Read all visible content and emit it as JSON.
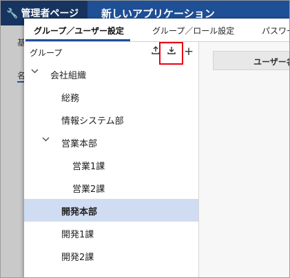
{
  "background": {
    "brand": "管理者ページ",
    "app_title": "新しいアプリケーション",
    "strip_label_1": "基",
    "strip_label_2": "名"
  },
  "tabs": [
    {
      "label": "グループ／ユーザー設定",
      "active": true
    },
    {
      "label": "グループ／ロール設定",
      "active": false
    },
    {
      "label": "パスワー",
      "active": false
    }
  ],
  "group_pane": {
    "title": "グループ",
    "icons": [
      "upload-icon",
      "download-icon",
      "plus-icon"
    ],
    "tree": [
      {
        "label": "会社組織",
        "level": 0,
        "expanded": true
      },
      {
        "label": "総務",
        "level": 1
      },
      {
        "label": "情報システム部",
        "level": 1
      },
      {
        "label": "営業本部",
        "level": 1,
        "expanded": true
      },
      {
        "label": "営業1課",
        "level": 2
      },
      {
        "label": "営業2課",
        "level": 2
      },
      {
        "label": "開発本部",
        "level": 1,
        "selected": true
      },
      {
        "label": "開発1課",
        "level": 1
      },
      {
        "label": "開発2課",
        "level": 1
      }
    ]
  },
  "user_pane": {
    "column_header": "ユーザー名"
  },
  "colors": {
    "accent": "#1f4f94",
    "selected_row": "#cfdcf2",
    "highlight": "#e60012"
  }
}
